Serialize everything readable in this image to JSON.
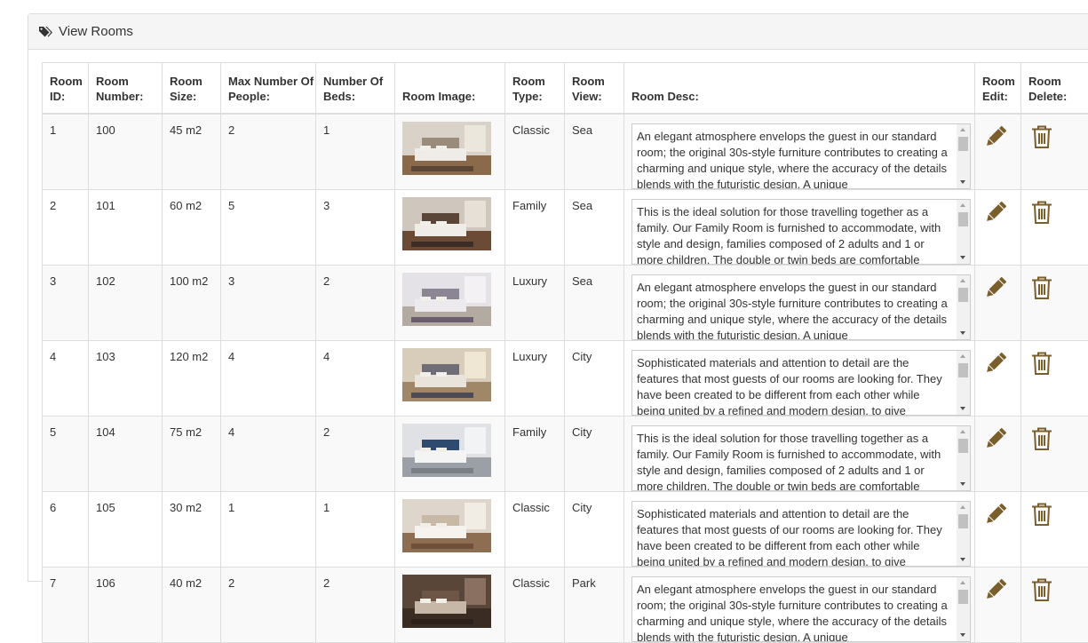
{
  "panel": {
    "title": "View Rooms",
    "icon": "tag-icon"
  },
  "table": {
    "headers": {
      "id": "Room ID:",
      "number": "Room Number:",
      "size": "Room Size:",
      "max_people": "Max Number Of People:",
      "beds": "Number Of Beds:",
      "image": "Room Image:",
      "type": "Room Type:",
      "view": "Room View:",
      "desc": "Room Desc:",
      "edit": "Room Edit:",
      "delete": "Room Delete:"
    },
    "rows": [
      {
        "id": "1",
        "number": "100",
        "size": "45 m2",
        "max_people": "2",
        "beds": "1",
        "type": "Classic",
        "view": "Sea",
        "desc": "An elegant atmosphere envelops the guest in our standard room; the original 30s-style furniture contributes to creating a charming and unique style, where the accuracy of the details blends with the futuristic design. A unique"
      },
      {
        "id": "2",
        "number": "101",
        "size": "60 m2",
        "max_people": "5",
        "beds": "3",
        "type": "Family",
        "view": "Sea",
        "desc": "This is the ideal solution for those travelling together as a family. Our Family Room is furnished to accommodate, with style and design, families composed of 2 adults and 1 or more children. The double or twin beds are comfortable"
      },
      {
        "id": "3",
        "number": "102",
        "size": "100 m2",
        "max_people": "3",
        "beds": "2",
        "type": "Luxury",
        "view": "Sea",
        "desc": "An elegant atmosphere envelops the guest in our standard room; the original 30s-style furniture contributes to creating a charming and unique style, where the accuracy of the details blends with the futuristic design. A unique"
      },
      {
        "id": "4",
        "number": "103",
        "size": "120 m2",
        "max_people": "4",
        "beds": "4",
        "type": "Luxury",
        "view": "City",
        "desc": "Sophisticated materials and attention to detail are the features that most guests of our rooms are looking for. They have been created to be different from each other while being united by a refined and modern design, to give"
      },
      {
        "id": "5",
        "number": "104",
        "size": "75 m2",
        "max_people": "4",
        "beds": "2",
        "type": "Family",
        "view": "City",
        "desc": "This is the ideal solution for those travelling together as a family. Our Family Room is furnished to accommodate, with style and design, families composed of 2 adults and 1 or more children. The double or twin beds are comfortable"
      },
      {
        "id": "6",
        "number": "105",
        "size": "30 m2",
        "max_people": "1",
        "beds": "1",
        "type": "Classic",
        "view": "City",
        "desc": "Sophisticated materials and attention to detail are the features that most guests of our rooms are looking for. They have been created to be different from each other while being united by a refined and modern design, to give"
      },
      {
        "id": "7",
        "number": "106",
        "size": "40 m2",
        "max_people": "2",
        "beds": "2",
        "type": "Classic",
        "view": "Park",
        "desc": "An elegant atmosphere envelops the guest in our standard room; the original 30s-style furniture contributes to creating a charming and unique style, where the accuracy of the details blends with the futuristic design. A unique"
      }
    ]
  },
  "icons": {
    "edit": "pencil-icon",
    "delete": "trash-icon"
  },
  "colors": {
    "action_icon": "#7a5f2c",
    "border": "#dddddd",
    "heading_bg": "#f5f5f5",
    "stripe": "#f9f9f9"
  }
}
